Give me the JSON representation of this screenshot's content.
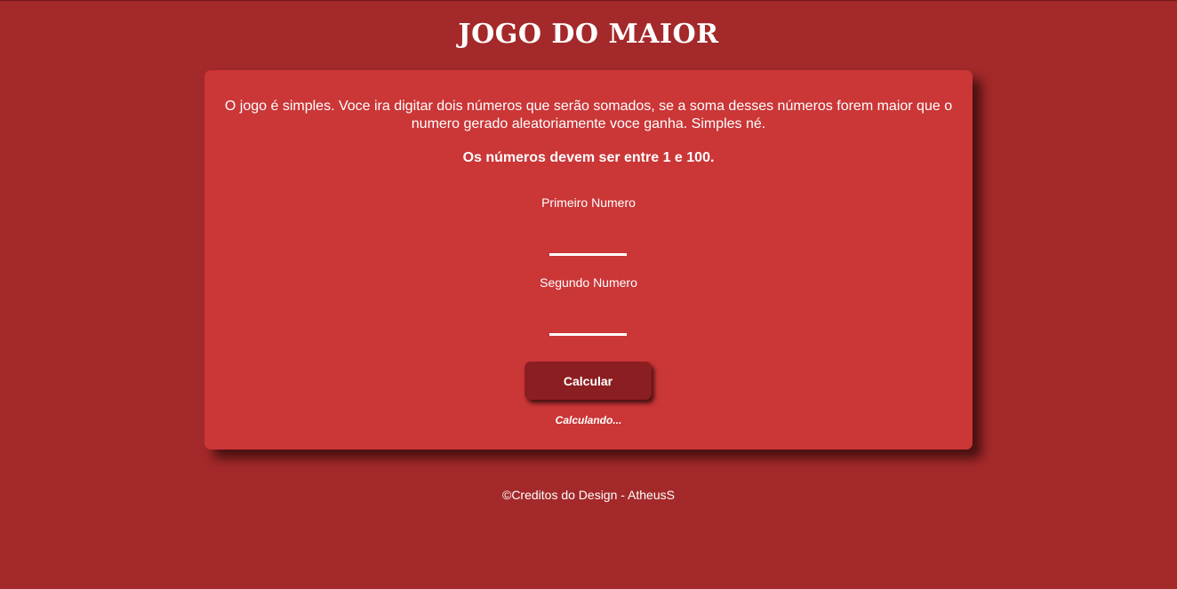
{
  "header": {
    "title": "JOGO DO MAIOR"
  },
  "game": {
    "intro": "O jogo é simples. Voce ira digitar dois números que serão somados, se a soma desses números forem maior que o numero gerado aleatoriamente voce ganha. Simples né.",
    "rule": "Os números devem ser entre 1 e 100.",
    "first_label": "Primeiro Numero",
    "first_value": "",
    "second_label": "Segundo Numero",
    "second_value": "",
    "button_label": "Calcular",
    "status": "Calculando..."
  },
  "footer": {
    "credits": "©Creditos do Design - AtheusS"
  },
  "colors": {
    "page_background": "#a4292a",
    "card_background": "#cb3637",
    "button_background": "#8b1e20",
    "text": "#ffffff"
  }
}
